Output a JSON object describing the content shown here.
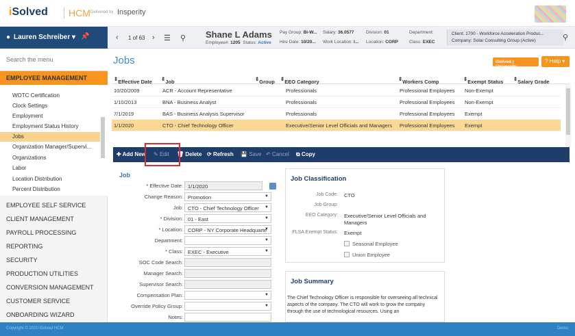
{
  "brand": {
    "logo_i": "i",
    "logo_rest": "Solved",
    "hcm": "HCM",
    "delivered_by": "Delivered by",
    "partner": "Insperity"
  },
  "user": {
    "name": "Lauren Schreiber ▾"
  },
  "employee_header": {
    "pager": "1 of 63",
    "name": "Shane L Adams",
    "employee_num_label": "Employee#:",
    "employee_num": "1205",
    "status_label": "Status:",
    "status": "Active",
    "pay_group_label": "Pay Group:",
    "pay_group": "Bi-W...",
    "hire_date_label": "Hire Date:",
    "hire_date": "10/20...",
    "salary_label": "Salary:",
    "salary": "36.0577",
    "work_location_label": "Work Location:",
    "work_location": "I...",
    "division_label": "Division:",
    "division": "01",
    "location_label": "Location:",
    "location": "CORP",
    "department_label": "Department:",
    "department": "",
    "class_label": "Class:",
    "class": "EXEC",
    "client_line": "Client: 1700 - Workforce Acceleration Produc...",
    "company_line": "Company: Solar Consulting Group (Active)"
  },
  "sidebar": {
    "search_placeholder": "Search the menu",
    "active_section": "EMPLOYEE MANAGEMENT",
    "sub_items": [
      "WOTC Certification",
      "Clock Settings",
      "Employment",
      "Employment Status History",
      "Jobs",
      "Organization Manager/Supervi...",
      "Organizations",
      "Labor",
      "Location Distribution",
      "Percent Distribution"
    ],
    "selected_sub": "Jobs",
    "sections": [
      "EMPLOYEE SELF SERVICE",
      "CLIENT MANAGEMENT",
      "PAYROLL PROCESSING",
      "REPORTING",
      "SECURITY",
      "PRODUCTION UTILITIES",
      "CONVERSION MANAGEMENT",
      "CUSTOMER SERVICE",
      "ONBOARDING WIZARD"
    ]
  },
  "page": {
    "title": "Jobs",
    "university_btn": "iSolved | University",
    "help_btn": "? Help ▾"
  },
  "grid": {
    "columns": [
      "Effective Date",
      "Job",
      "Group",
      "EEO Category",
      "Workers Comp",
      "Exempt Status",
      "Salary Grade"
    ],
    "rows": [
      [
        "10/20/2009",
        "ACR - Account Representative",
        "",
        "Professionals",
        "Professional Employees",
        "Non-Exempt",
        ""
      ],
      [
        "1/10/2013",
        "BNA - Business Analyst",
        "",
        "Professionals",
        "Professional Employees",
        "Non-Exempt",
        ""
      ],
      [
        "7/1/2019",
        "BAS - Business Analysis Supervisor",
        "",
        "Professionals",
        "Professional Employees",
        "Exempt",
        ""
      ],
      [
        "1/1/2020",
        "CTO - Chief Technology Officer",
        "",
        "Executive/Senior Level Officials and Managers",
        "Professional Employees",
        "Exempt",
        ""
      ]
    ]
  },
  "toolbar": {
    "add": "Add New",
    "edit": "Edit",
    "delete": "Delete",
    "refresh": "Refresh",
    "save": "Save",
    "cancel": "Cancel",
    "copy": "Copy"
  },
  "form": {
    "section_title": "Job",
    "fields": [
      {
        "label": "* Effective Date:",
        "value": "1/1/2020"
      },
      {
        "label": "Change Reason:",
        "value": "Promotion"
      },
      {
        "label": "Job:",
        "value": "CTO - Chief Technology Officer"
      },
      {
        "label": "* Division:",
        "value": "01 - East"
      },
      {
        "label": "* Location:",
        "value": "CORP - NY Corporate Headquarte"
      },
      {
        "label": "Department:",
        "value": ""
      },
      {
        "label": "* Class:",
        "value": "EXEC - Executive"
      },
      {
        "label": "SOC Code Search:",
        "value": ""
      },
      {
        "label": "Manager Search:",
        "value": ""
      },
      {
        "label": "Supervisor Search:",
        "value": ""
      },
      {
        "label": "Compensation Plan:",
        "value": ""
      },
      {
        "label": "Override Policy Group:",
        "value": ""
      },
      {
        "label": "Notes:",
        "value": ""
      }
    ]
  },
  "classification": {
    "title": "Job Classification",
    "job_code_label": "Job Code:",
    "job_code": "CTO",
    "job_group_label": "Job Group:",
    "job_group": "",
    "eeo_label": "EEO Category:",
    "eeo": "Executive/Senior Level Officials and Managers",
    "flsa_label": "FLSA Exempt Status:",
    "flsa": "Exempt",
    "seasonal": "Seasonal Employee",
    "union": "Union Employee"
  },
  "summary": {
    "title": "Job Summary",
    "text": "The Chief Technology Officer is responsible for overseeing all technical aspects of the company. The CTO will work to grow the company through the use of technological resources. Using an"
  },
  "footer": {
    "copyright": "Copyright © 2020 iSolved HCM",
    "env": "Demo"
  }
}
